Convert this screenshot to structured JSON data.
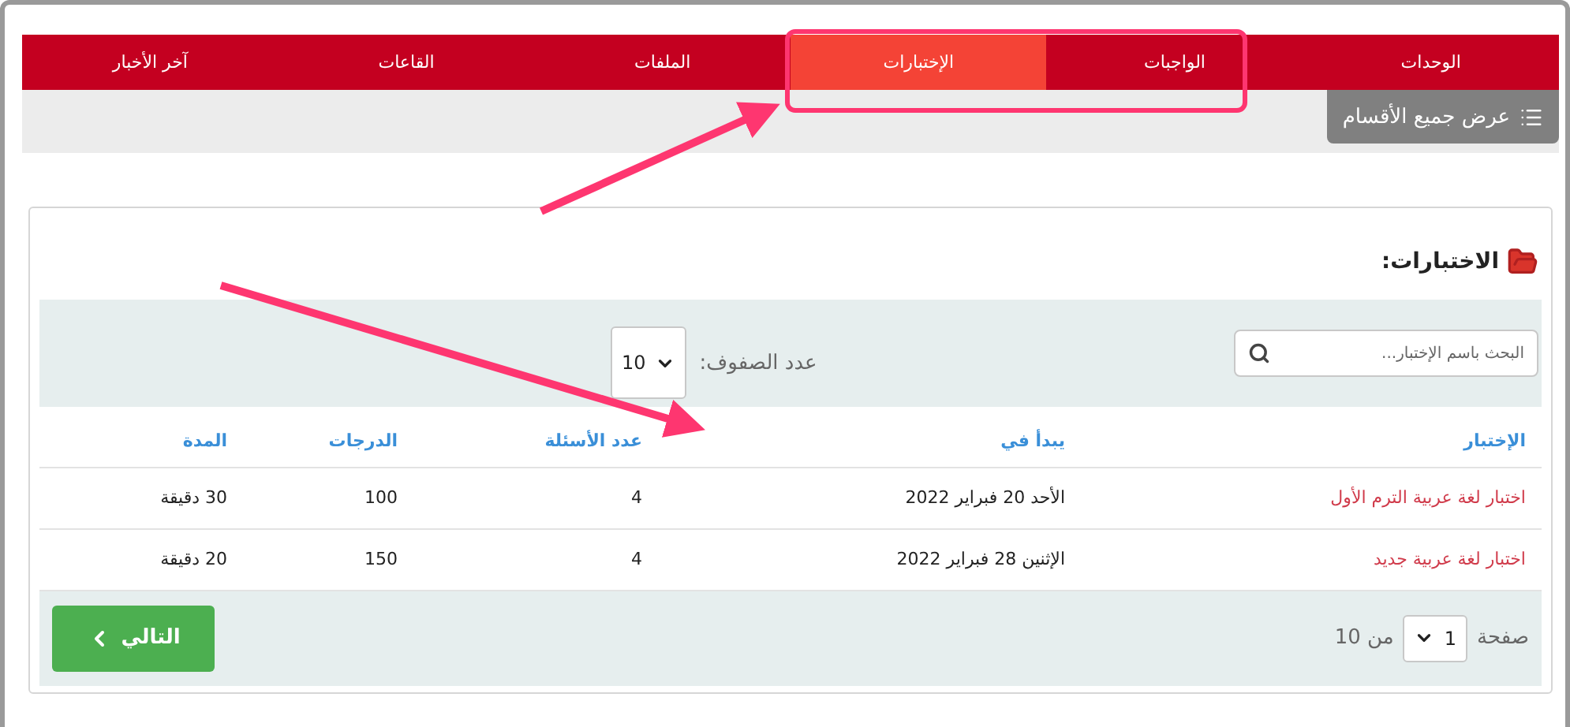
{
  "nav": {
    "tabs": [
      {
        "label": "الوحدات",
        "selected": false
      },
      {
        "label": "الواجبات",
        "selected": false
      },
      {
        "label": "الإختبارات",
        "selected": true
      },
      {
        "label": "الملفات",
        "selected": false
      },
      {
        "label": "القاعات",
        "selected": false
      },
      {
        "label": "آخر الأخبار",
        "selected": false
      }
    ]
  },
  "show_all_button": {
    "label": "عرض جميع الأقسام"
  },
  "panel": {
    "title": "الاختبارات:",
    "search": {
      "placeholder": "البحث باسم الإختبار..."
    },
    "rows_per_page": {
      "label": "عدد الصفوف:",
      "value": "10"
    }
  },
  "table": {
    "columns": [
      "الإختبار",
      "يبدأ في",
      "عدد الأسئلة",
      "الدرجات",
      "المدة"
    ],
    "rows": [
      [
        "اختبار لغة عربية الترم الأول",
        "الأحد 20 فبراير 2022",
        "4",
        "100",
        "30 دقيقة"
      ],
      [
        "اختبار لغة عربية جديد",
        "الإثنين 28 فبراير 2022",
        "4",
        "150",
        "20 دقيقة"
      ]
    ]
  },
  "pagination": {
    "page_label": "صفحة",
    "page": "1",
    "of_label": "من 10",
    "next_button": "التالي"
  }
}
